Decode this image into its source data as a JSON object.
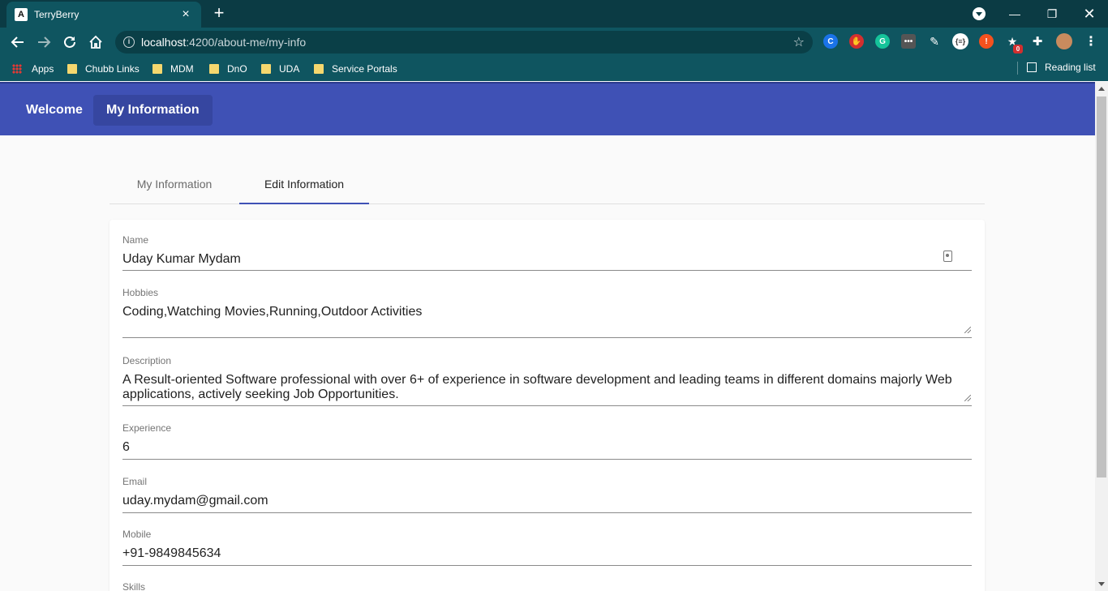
{
  "browser": {
    "tab_title": "TerryBerry",
    "tab_favicon_letter": "A",
    "url_host": "localhost",
    "url_rest": ":4200/about-me/my-info",
    "bookmarks": [
      "Apps",
      "Chubb Links",
      "MDM",
      "DnO",
      "UDA",
      "Service Portals"
    ],
    "reading_list": "Reading list",
    "extension_badge": "0"
  },
  "appbar": {
    "nav": [
      "Welcome",
      "My Information"
    ]
  },
  "tabs": [
    "My Information",
    "Edit Information"
  ],
  "form": {
    "name": {
      "label": "Name",
      "value": "Uday Kumar Mydam"
    },
    "hobbies": {
      "label": "Hobbies",
      "value": "Coding,Watching Movies,Running,Outdoor Activities"
    },
    "description": {
      "label": "Description",
      "line1": "A Result-oriented Software professional with over 6+ of experience in software development and leading teams in different domains majorly Web",
      "line2": "applications, actively seeking Job Opportunities."
    },
    "experience": {
      "label": "Experience",
      "value": "6"
    },
    "email": {
      "label": "Email",
      "value": "uday.mydam@gmail.com"
    },
    "mobile": {
      "label": "Mobile",
      "value": "+91-9849845634"
    },
    "skills": {
      "label": "Skills"
    }
  },
  "colors": {
    "primary": "#3f51b5",
    "chrome_dark": "#0b3b44",
    "chrome": "#0f5560"
  }
}
